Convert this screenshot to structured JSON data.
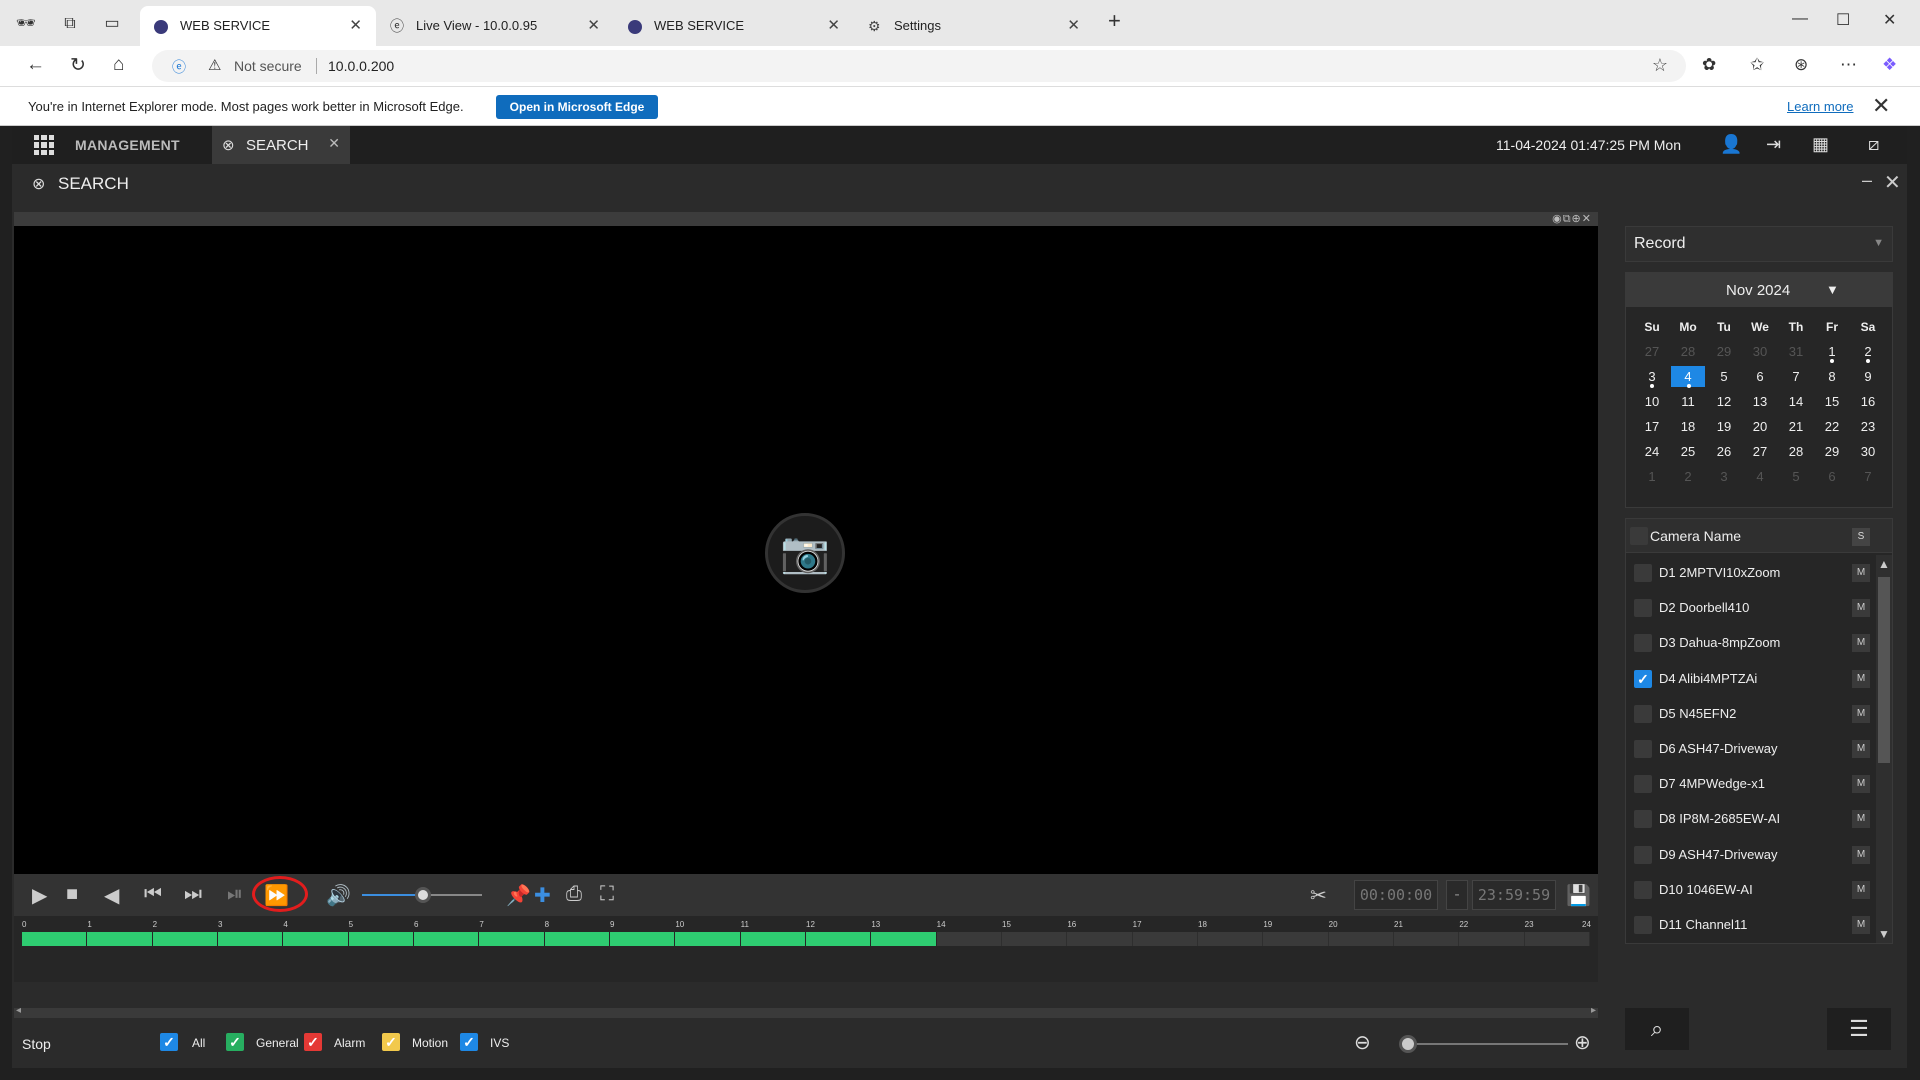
{
  "browser": {
    "tabs": [
      {
        "label": "WEB SERVICE",
        "active": true
      },
      {
        "label": "Live View - 10.0.0.95"
      },
      {
        "label": "WEB SERVICE"
      },
      {
        "label": "Settings"
      }
    ],
    "address": {
      "security": "Not secure",
      "url": "10.0.0.200"
    },
    "ie_bar": {
      "message": "You're in Internet Explorer mode. Most pages work better in Microsoft Edge.",
      "open_button": "Open in Microsoft Edge",
      "learn_more": "Learn more"
    }
  },
  "app": {
    "management": "MANAGEMENT",
    "search_tab": "SEARCH",
    "datetime": "11-04-2024 01:47:25 PM Mon",
    "page_title": "SEARCH"
  },
  "playback": {
    "volume": 0.52,
    "start_time": "00:00:00",
    "end_time": "23:59:59",
    "timeline_hours": [
      "0",
      "1",
      "2",
      "3",
      "4",
      "5",
      "6",
      "7",
      "8",
      "9",
      "10",
      "11",
      "12",
      "13",
      "14",
      "15",
      "16",
      "17",
      "18",
      "19",
      "20",
      "21",
      "22",
      "23",
      "24"
    ],
    "recorded_hours": 14,
    "status": "Stop",
    "zoom": 0
  },
  "filters": [
    {
      "label": "All",
      "color": "#1e88e5"
    },
    {
      "label": "General",
      "color": "#27ae60"
    },
    {
      "label": "Alarm",
      "color": "#e53935"
    },
    {
      "label": "Motion",
      "color": "#f2c94c"
    },
    {
      "label": "IVS",
      "color": "#1e88e5"
    }
  ],
  "record_type": "Record",
  "calendar": {
    "month": "Nov 2024",
    "weekdays": [
      "Su",
      "Mo",
      "Tu",
      "We",
      "Th",
      "Fr",
      "Sa"
    ],
    "days": [
      {
        "d": "27",
        "m": true
      },
      {
        "d": "28",
        "m": true
      },
      {
        "d": "29",
        "m": true
      },
      {
        "d": "30",
        "m": true
      },
      {
        "d": "31",
        "m": true
      },
      {
        "d": "1",
        "r": true
      },
      {
        "d": "2",
        "r": true
      },
      {
        "d": "3",
        "r": true
      },
      {
        "d": "4",
        "t": true,
        "r": true
      },
      {
        "d": "5"
      },
      {
        "d": "6"
      },
      {
        "d": "7"
      },
      {
        "d": "8"
      },
      {
        "d": "9"
      },
      {
        "d": "10"
      },
      {
        "d": "11"
      },
      {
        "d": "12"
      },
      {
        "d": "13"
      },
      {
        "d": "14"
      },
      {
        "d": "15"
      },
      {
        "d": "16"
      },
      {
        "d": "17"
      },
      {
        "d": "18"
      },
      {
        "d": "19"
      },
      {
        "d": "20"
      },
      {
        "d": "21"
      },
      {
        "d": "22"
      },
      {
        "d": "23"
      },
      {
        "d": "24"
      },
      {
        "d": "25"
      },
      {
        "d": "26"
      },
      {
        "d": "27"
      },
      {
        "d": "28"
      },
      {
        "d": "29"
      },
      {
        "d": "30"
      },
      {
        "d": "1",
        "m": true
      },
      {
        "d": "2",
        "m": true
      },
      {
        "d": "3",
        "m": true
      },
      {
        "d": "4",
        "m": true
      },
      {
        "d": "5",
        "m": true
      },
      {
        "d": "6",
        "m": true
      },
      {
        "d": "7",
        "m": true
      }
    ]
  },
  "camera_list": {
    "header": "Camera Name",
    "header_btn": "S",
    "row_btn": "M",
    "cameras": [
      {
        "name": "D1 2MPTVI10xZoom",
        "checked": false
      },
      {
        "name": "D2 Doorbell410",
        "checked": false
      },
      {
        "name": "D3 Dahua-8mpZoom",
        "checked": false
      },
      {
        "name": "D4 Alibi4MPTZAi",
        "checked": true
      },
      {
        "name": "D5 N45EFN2",
        "checked": false
      },
      {
        "name": "D6 ASH47-Driveway",
        "checked": false
      },
      {
        "name": "D7 4MPWedge-x1",
        "checked": false
      },
      {
        "name": "D8 IP8M-2685EW-AI",
        "checked": false
      },
      {
        "name": "D9 ASH47-Driveway",
        "checked": false
      },
      {
        "name": "D10 1046EW-AI",
        "checked": false
      },
      {
        "name": "D11 Channel11",
        "checked": false
      }
    ]
  }
}
